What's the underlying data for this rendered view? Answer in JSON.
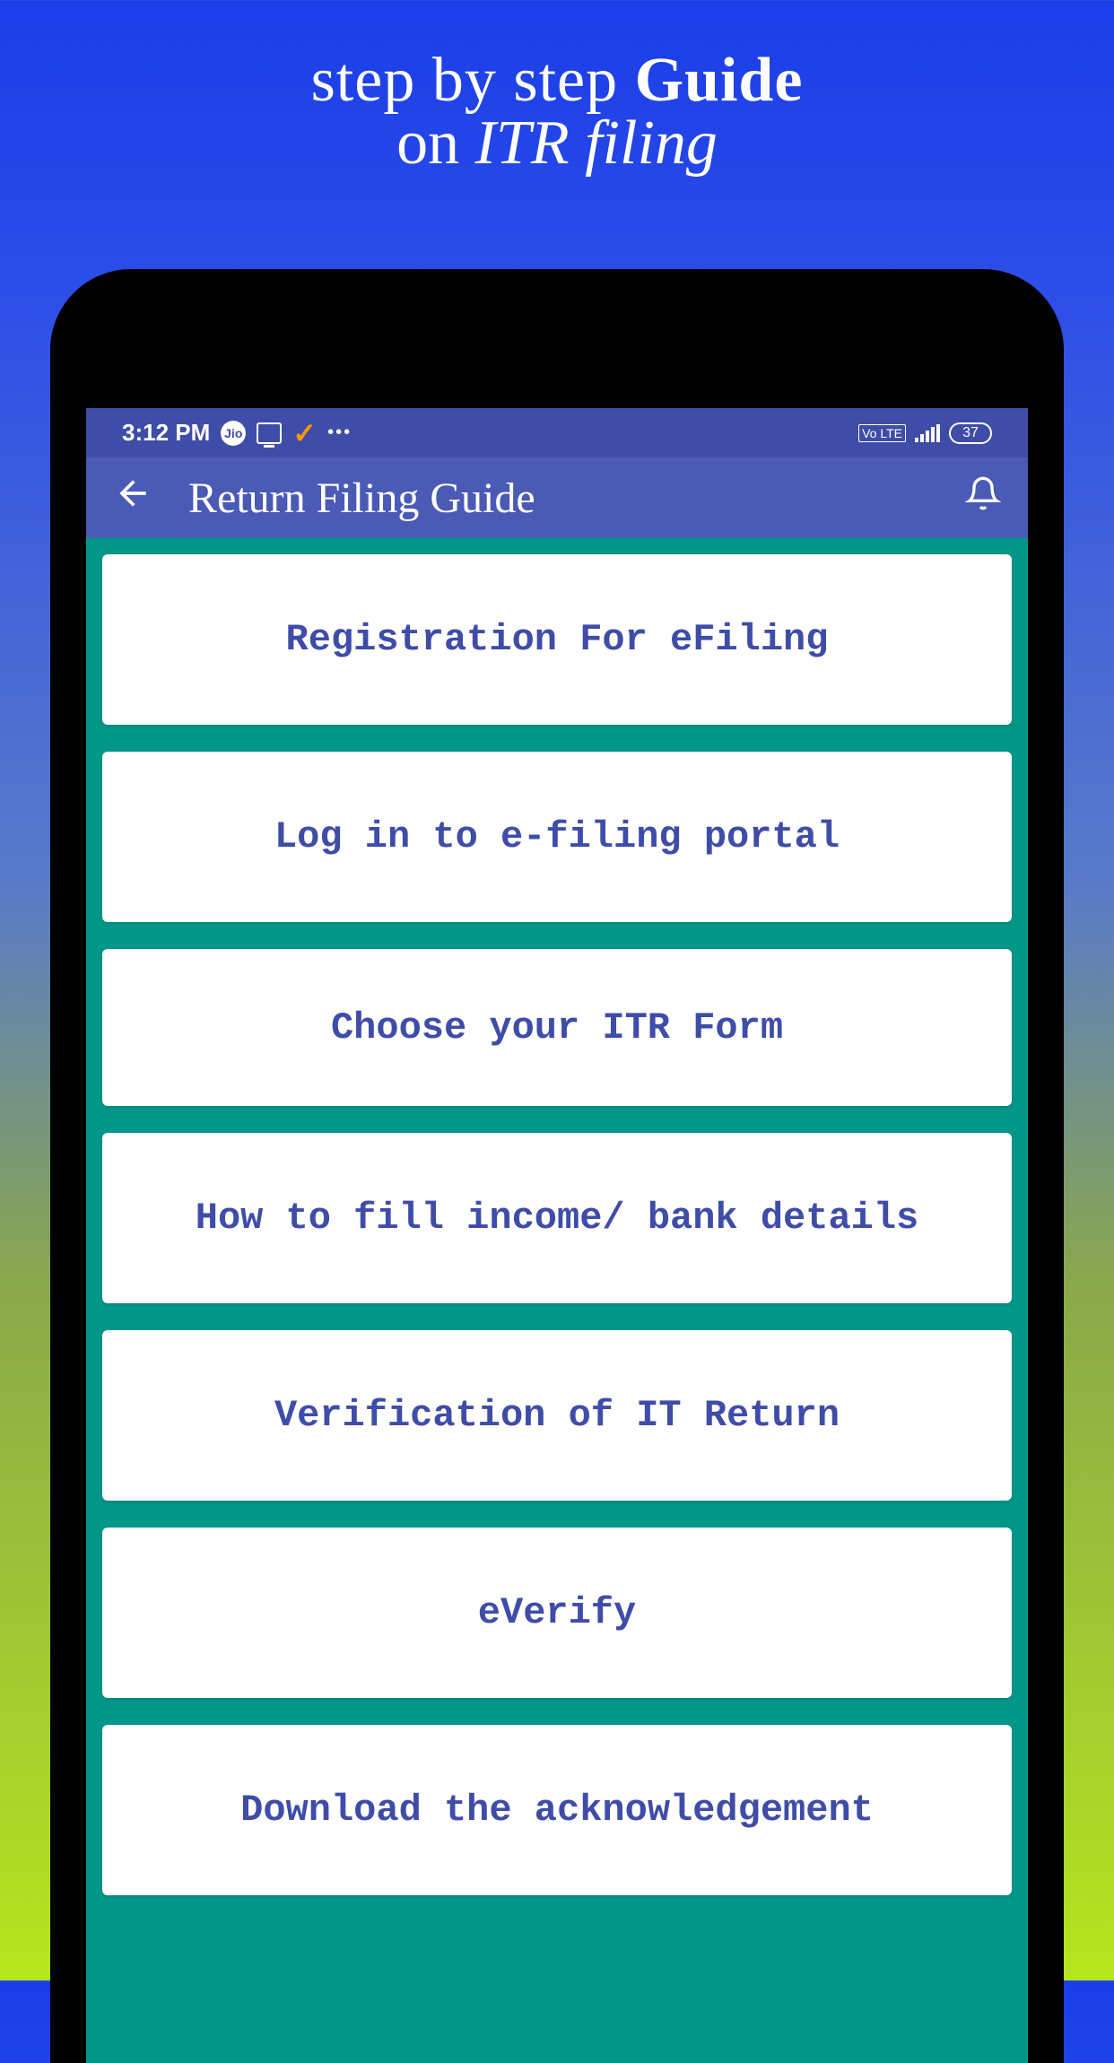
{
  "promo": {
    "line1_normal": "step by step ",
    "line1_bold": "Guide",
    "line2_normal": "on ",
    "line2_italic": "ITR filing"
  },
  "status_bar": {
    "time": "3:12 PM",
    "jio_label": "Jio",
    "check_glyph": "✓",
    "dots": "•••",
    "volte": "Vo LTE",
    "battery": "37"
  },
  "app_bar": {
    "title": "Return Filing Guide"
  },
  "list_items": [
    {
      "label": "Registration For eFiling"
    },
    {
      "label": "Log in to e-filing portal"
    },
    {
      "label": "Choose your ITR Form"
    },
    {
      "label": "How to fill income/ bank details"
    },
    {
      "label": "Verification of IT Return"
    },
    {
      "label": "eVerify"
    },
    {
      "label": "Download the acknowledgement"
    }
  ],
  "colors": {
    "app_bar_bg": "#4b5ab5",
    "status_bg": "#3f4ca8",
    "teal_bg": "#009688",
    "item_text": "#3f4ca8"
  }
}
